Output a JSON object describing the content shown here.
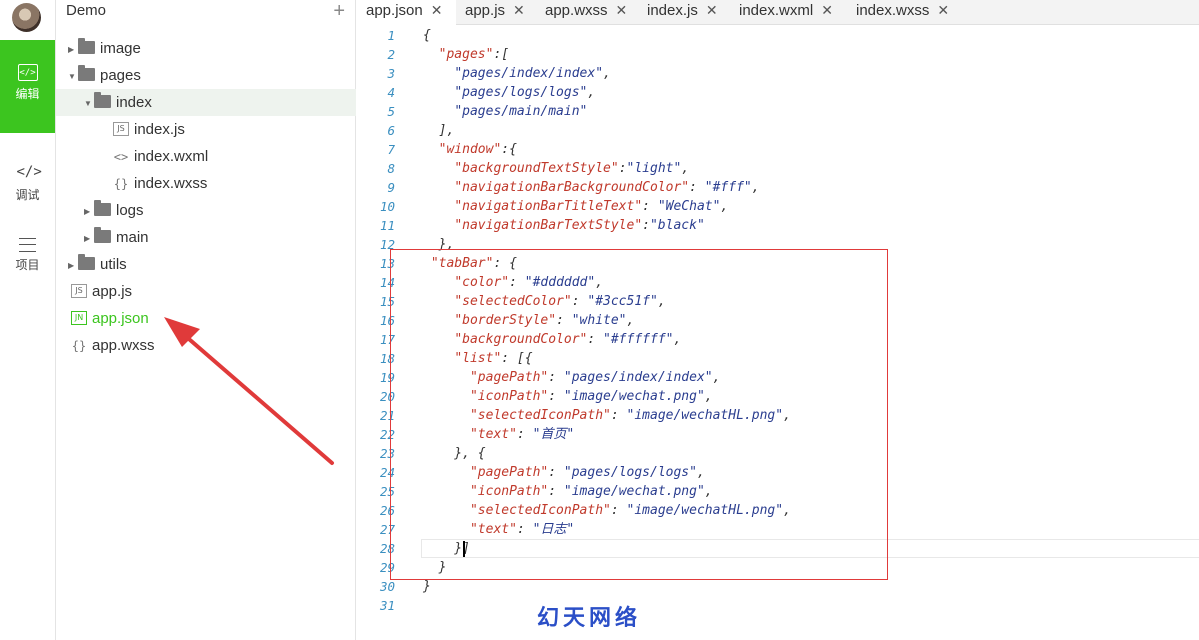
{
  "activity": {
    "items": [
      {
        "label": "编辑",
        "icon": "code-icon"
      },
      {
        "label": "调试",
        "icon": "debug-icon"
      },
      {
        "label": "项目",
        "icon": "menu-icon"
      }
    ]
  },
  "project": {
    "name": "Demo"
  },
  "tree": [
    {
      "label": "image",
      "type": "folder",
      "expanded": false
    },
    {
      "label": "pages",
      "type": "folder",
      "expanded": true
    },
    {
      "label": "index",
      "type": "folder",
      "expanded": true
    },
    {
      "label": "index.js",
      "type": "js"
    },
    {
      "label": "index.wxml",
      "type": "wxml"
    },
    {
      "label": "index.wxss",
      "type": "wxss"
    },
    {
      "label": "logs",
      "type": "folder",
      "expanded": false
    },
    {
      "label": "main",
      "type": "folder",
      "expanded": false
    },
    {
      "label": "utils",
      "type": "folder",
      "expanded": false
    },
    {
      "label": "app.js",
      "type": "js"
    },
    {
      "label": "app.json",
      "type": "json",
      "active": true
    },
    {
      "label": "app.wxss",
      "type": "wxss"
    }
  ],
  "tabs": [
    {
      "label": "app.json",
      "active": true
    },
    {
      "label": "app.js"
    },
    {
      "label": "app.wxss"
    },
    {
      "label": "index.js"
    },
    {
      "label": "index.wxml"
    },
    {
      "label": "index.wxss"
    }
  ],
  "editor": {
    "line_numbers": [
      "1",
      "2",
      "3",
      "4",
      "5",
      "6",
      "7",
      "8",
      "9",
      "10",
      "11",
      "12",
      "13",
      "14",
      "15",
      "16",
      "17",
      "18",
      "19",
      "20",
      "21",
      "22",
      "23",
      "24",
      "25",
      "26",
      "27",
      "28",
      "29",
      "30",
      "31"
    ],
    "lines": [
      "{",
      "  \"pages\":[",
      "    \"pages/index/index\",",
      "    \"pages/logs/logs\",",
      "    \"pages/main/main\"",
      "  ],",
      "  \"window\":{",
      "    \"backgroundTextStyle\":\"light\",",
      "    \"navigationBarBackgroundColor\": \"#fff\",",
      "    \"navigationBarTitleText\": \"WeChat\",",
      "    \"navigationBarTextStyle\":\"black\"",
      "  },",
      " \"tabBar\": {",
      "    \"color\": \"#dddddd\",",
      "    \"selectedColor\": \"#3cc51f\",",
      "    \"borderStyle\": \"white\",",
      "    \"backgroundColor\": \"#ffffff\",",
      "    \"list\": [{",
      "      \"pagePath\": \"pages/index/index\",",
      "      \"iconPath\": \"image/wechat.png\",",
      "      \"selectedIconPath\": \"image/wechatHL.png\",",
      "      \"text\": \"首页\"",
      "    }, {",
      "      \"pagePath\": \"pages/logs/logs\",",
      "      \"iconPath\": \"image/wechat.png\",",
      "      \"selectedIconPath\": \"image/wechatHL.png\",",
      "      \"text\": \"日志\"",
      "    }]",
      "  }",
      "}",
      ""
    ]
  },
  "watermark": "幻天网络",
  "colors": {
    "accent": "#3cc51f",
    "highlight": "#e03a3a",
    "line_number": "#3b8fc0",
    "key": "#c0392b",
    "value": "#2a3d8f"
  }
}
